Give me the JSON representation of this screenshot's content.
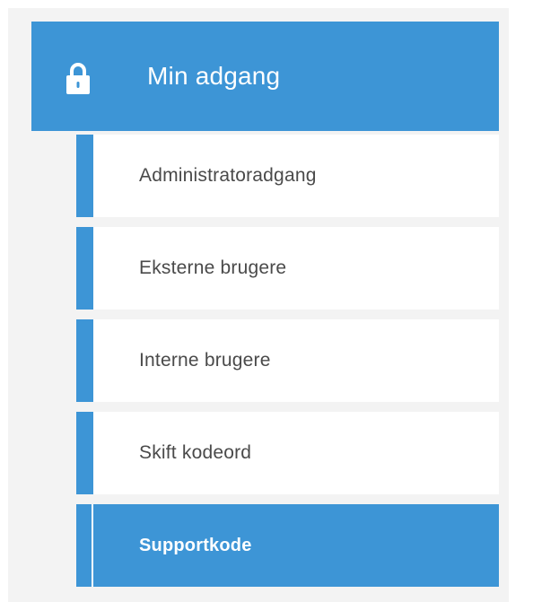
{
  "header": {
    "title": "Min adgang",
    "icon": "lock-icon"
  },
  "menu": {
    "items": [
      {
        "label": "Administratoradgang",
        "active": false
      },
      {
        "label": "Eksterne brugere",
        "active": false
      },
      {
        "label": "Interne brugere",
        "active": false
      },
      {
        "label": "Skift kodeord",
        "active": false
      },
      {
        "label": "Supportkode",
        "active": true
      }
    ]
  },
  "colors": {
    "accent": "#3d95d6",
    "background": "#f3f3f3",
    "item_background": "#ffffff",
    "item_text": "#4a4a4a",
    "active_text": "#ffffff"
  }
}
